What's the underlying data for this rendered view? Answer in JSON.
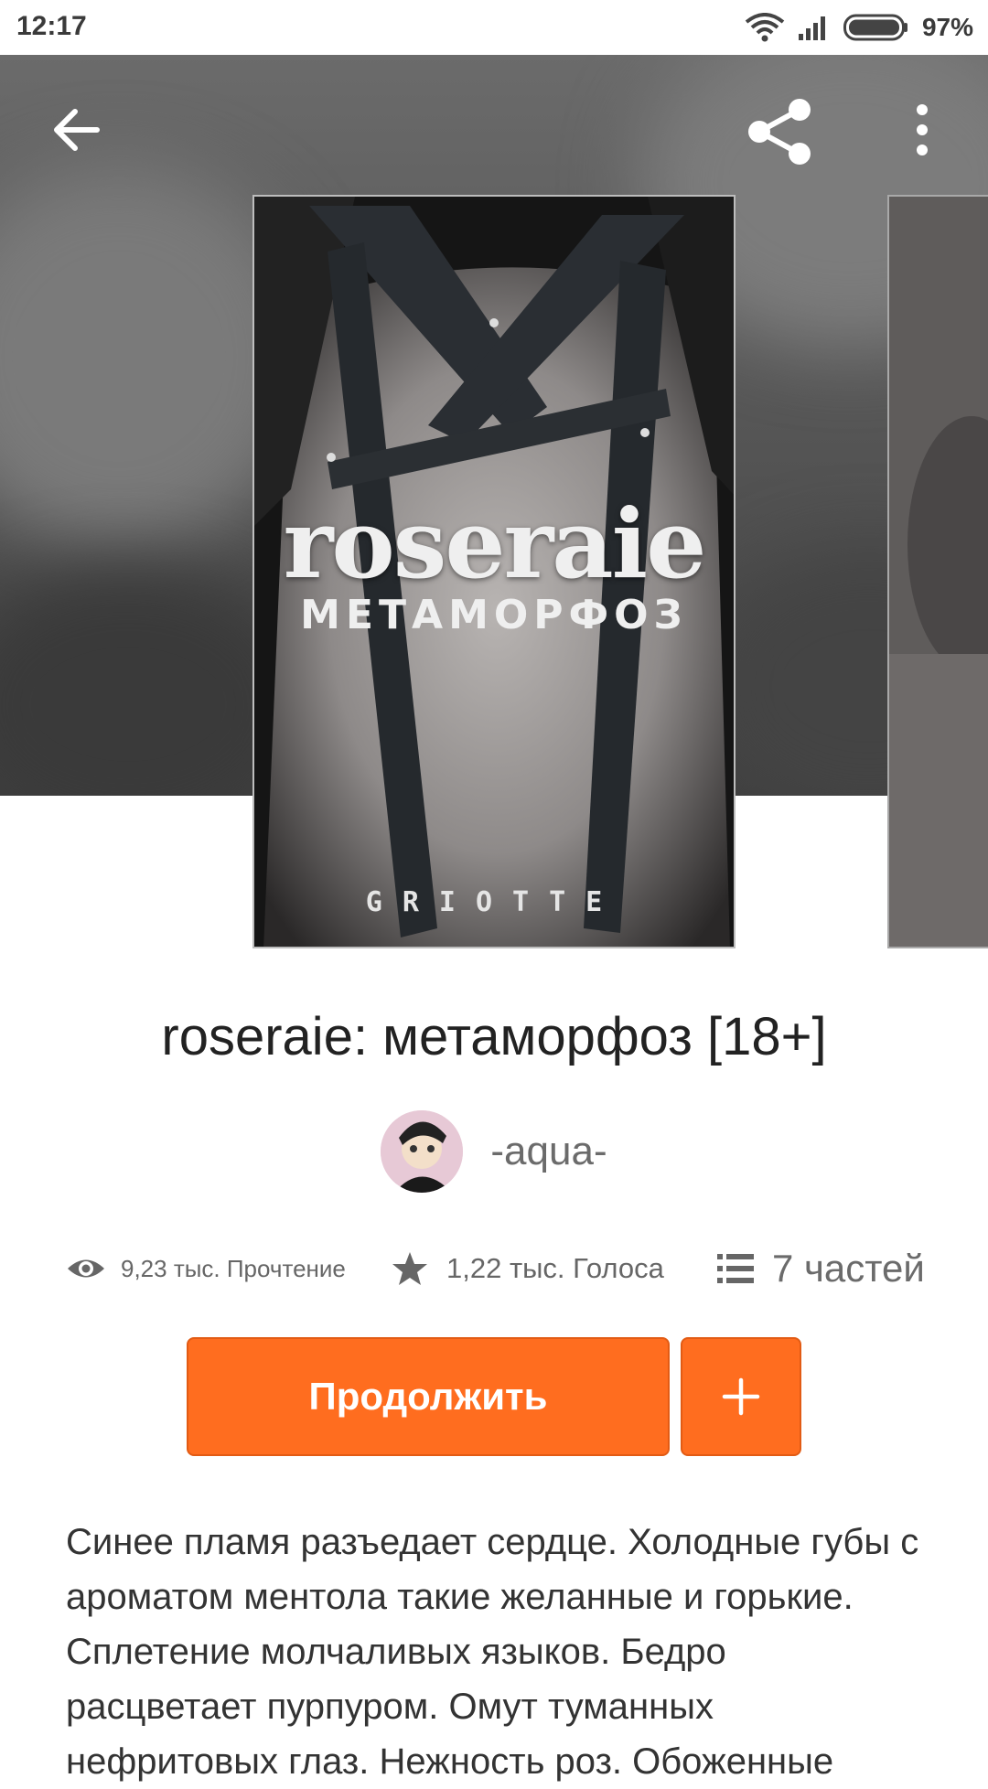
{
  "status_bar": {
    "time": "12:17",
    "battery": "97%"
  },
  "icons": {
    "back": "arrow-left-icon",
    "share": "share-icon",
    "more": "more-vertical-icon",
    "views": "eye-icon",
    "votes": "star-icon",
    "parts": "list-icon",
    "add": "plus-icon"
  },
  "cover": {
    "title": "roseraie",
    "subtitle": "МЕТАМОРФОЗ",
    "author": "GRIOTTE"
  },
  "story": {
    "title": "roseraie: метаморфоз [18+]",
    "author": "-aqua-",
    "reads": "9,23 тыс. Прочтение",
    "votes": "1,22 тыс. Голоса",
    "parts": "7 частей"
  },
  "actions": {
    "continue_label": "Продолжить",
    "add_label": "+"
  },
  "description": "Синее пламя разъедает сердце. Холодные губы с ароматом ментола такие желанные и горькие. Сплетение молчаливых языков. Бедро расцветает пурпуром. Омут туманных нефритовых глаз. Нежность роз. Обоженные",
  "colors": {
    "accent": "#ff6d1f",
    "text": "#222222",
    "muted": "#6b6b6b"
  }
}
